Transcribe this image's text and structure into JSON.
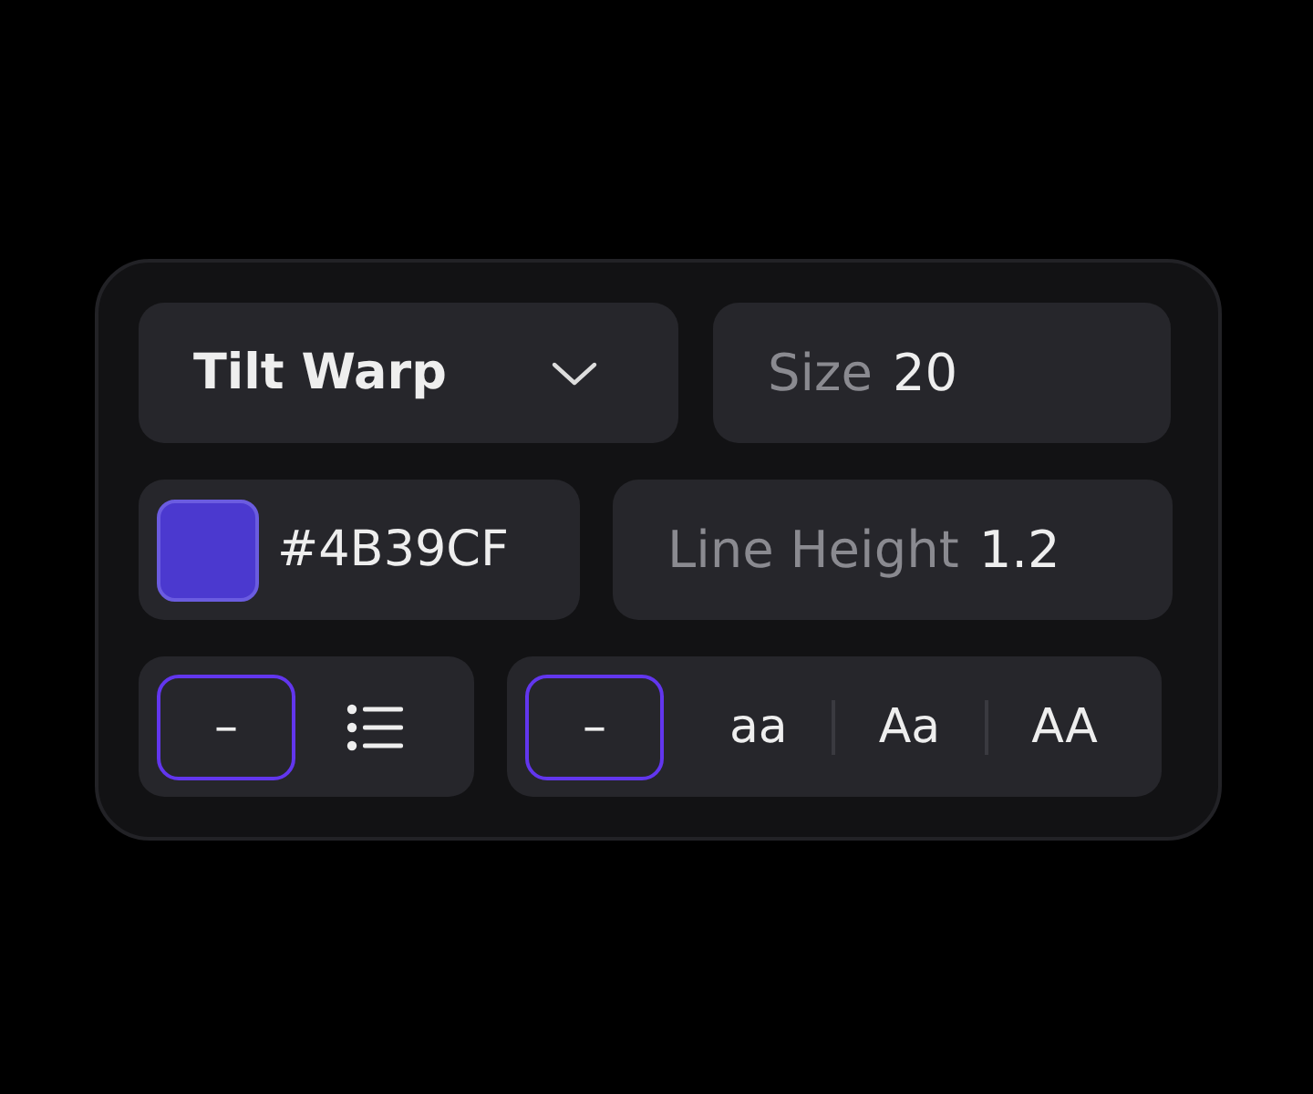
{
  "font_picker": {
    "value": "Tilt Warp"
  },
  "size": {
    "label": "Size",
    "value": "20"
  },
  "color": {
    "value": "#4B39CF"
  },
  "line_height": {
    "label": "Line Height",
    "value": "1.2"
  },
  "list_style": [
    {
      "kind": "none",
      "label": "–",
      "selected": true
    },
    {
      "kind": "bulleted",
      "selected": false
    }
  ],
  "text_case": [
    {
      "kind": "none",
      "label": "–",
      "selected": true
    },
    {
      "kind": "text",
      "label": "aa",
      "selected": false
    },
    {
      "kind": "text",
      "label": "Aa",
      "selected": false
    },
    {
      "kind": "text",
      "label": "AA",
      "selected": false
    }
  ]
}
